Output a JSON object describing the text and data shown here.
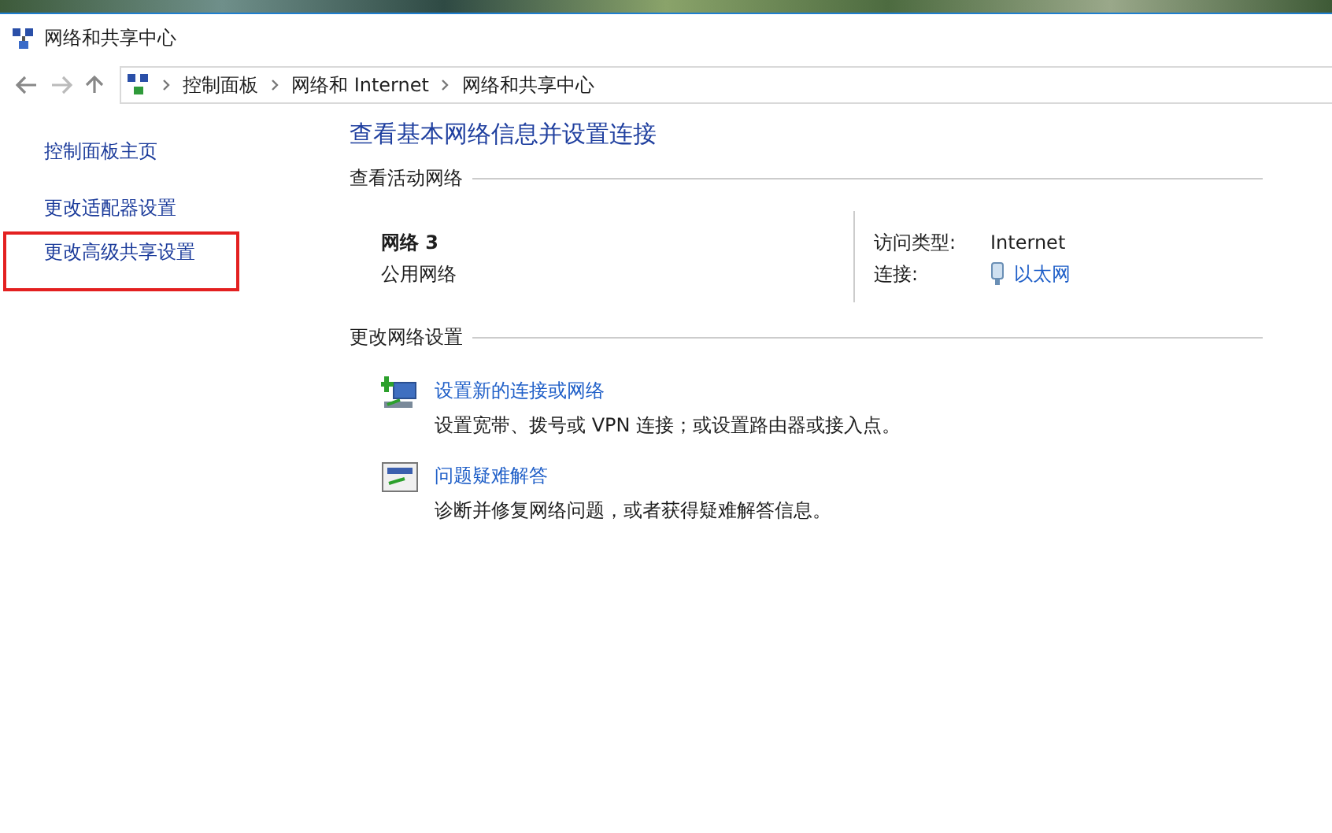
{
  "window": {
    "title": "网络和共享中心"
  },
  "address_bar": {
    "breadcrumbs": [
      "控制面板",
      "网络和 Internet",
      "网络和共享中心"
    ]
  },
  "sidebar": {
    "items": [
      {
        "label": "控制面板主页",
        "highlighted": false
      },
      {
        "label": "更改适配器设置",
        "highlighted": false
      },
      {
        "label": "更改高级共享设置",
        "highlighted": true
      }
    ]
  },
  "main": {
    "title": "查看基本网络信息并设置连接",
    "active_networks": {
      "heading": "查看活动网络",
      "name": "网络 3",
      "category": "公用网络",
      "access_type_label": "访问类型:",
      "access_type": "Internet",
      "connections_label": "连接:",
      "connection": "以太网"
    },
    "change_settings": {
      "heading": "更改网络设置",
      "tasks": [
        {
          "kind": "new-connection",
          "link": "设置新的连接或网络",
          "description": "设置宽带、拨号或 VPN 连接；或设置路由器或接入点。"
        },
        {
          "kind": "troubleshoot",
          "link": "问题疑难解答",
          "description": "诊断并修复网络问题，或者获得疑难解答信息。"
        }
      ]
    }
  }
}
